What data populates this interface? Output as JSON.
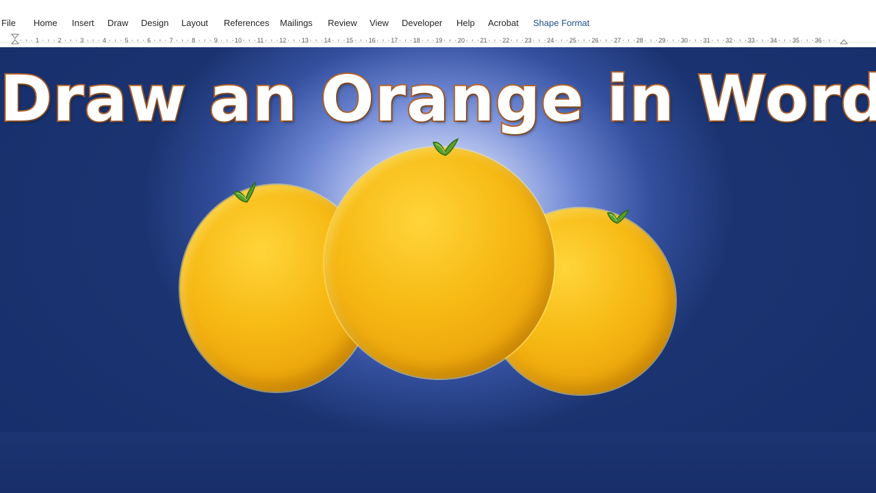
{
  "menu": {
    "items": [
      {
        "label": "File"
      },
      {
        "label": "Home"
      },
      {
        "label": "Insert"
      },
      {
        "label": "Draw"
      },
      {
        "label": "Design"
      },
      {
        "label": "Layout"
      },
      {
        "label": "References"
      },
      {
        "label": "Mailings"
      },
      {
        "label": "Review"
      },
      {
        "label": "View"
      },
      {
        "label": "Developer"
      },
      {
        "label": "Help"
      },
      {
        "label": "Acrobat"
      },
      {
        "label": "Shape Format"
      }
    ],
    "active": "Shape Format",
    "active_color": "#1f4e8c"
  },
  "ruler": {
    "numbers": [
      "1",
      "2",
      "3",
      "4",
      "5",
      "6",
      "7",
      "8",
      "9",
      "10",
      "11",
      "12",
      "13",
      "14",
      "15",
      "16",
      "17",
      "18",
      "19",
      "20",
      "21",
      "22",
      "23",
      "24",
      "25",
      "26",
      "27",
      "28",
      "29",
      "30",
      "31",
      "32",
      "33",
      "34",
      "35",
      "36"
    ]
  },
  "document": {
    "title": "Draw an Orange in Word",
    "title_fill": "#ffffff",
    "title_outline": "#b4642a",
    "background_color": "#1b3471",
    "orange_color": "#f7bb16",
    "leaf_color": "#6bb23a",
    "oranges": [
      {
        "name": "left-orange"
      },
      {
        "name": "center-orange"
      },
      {
        "name": "right-orange"
      }
    ]
  }
}
